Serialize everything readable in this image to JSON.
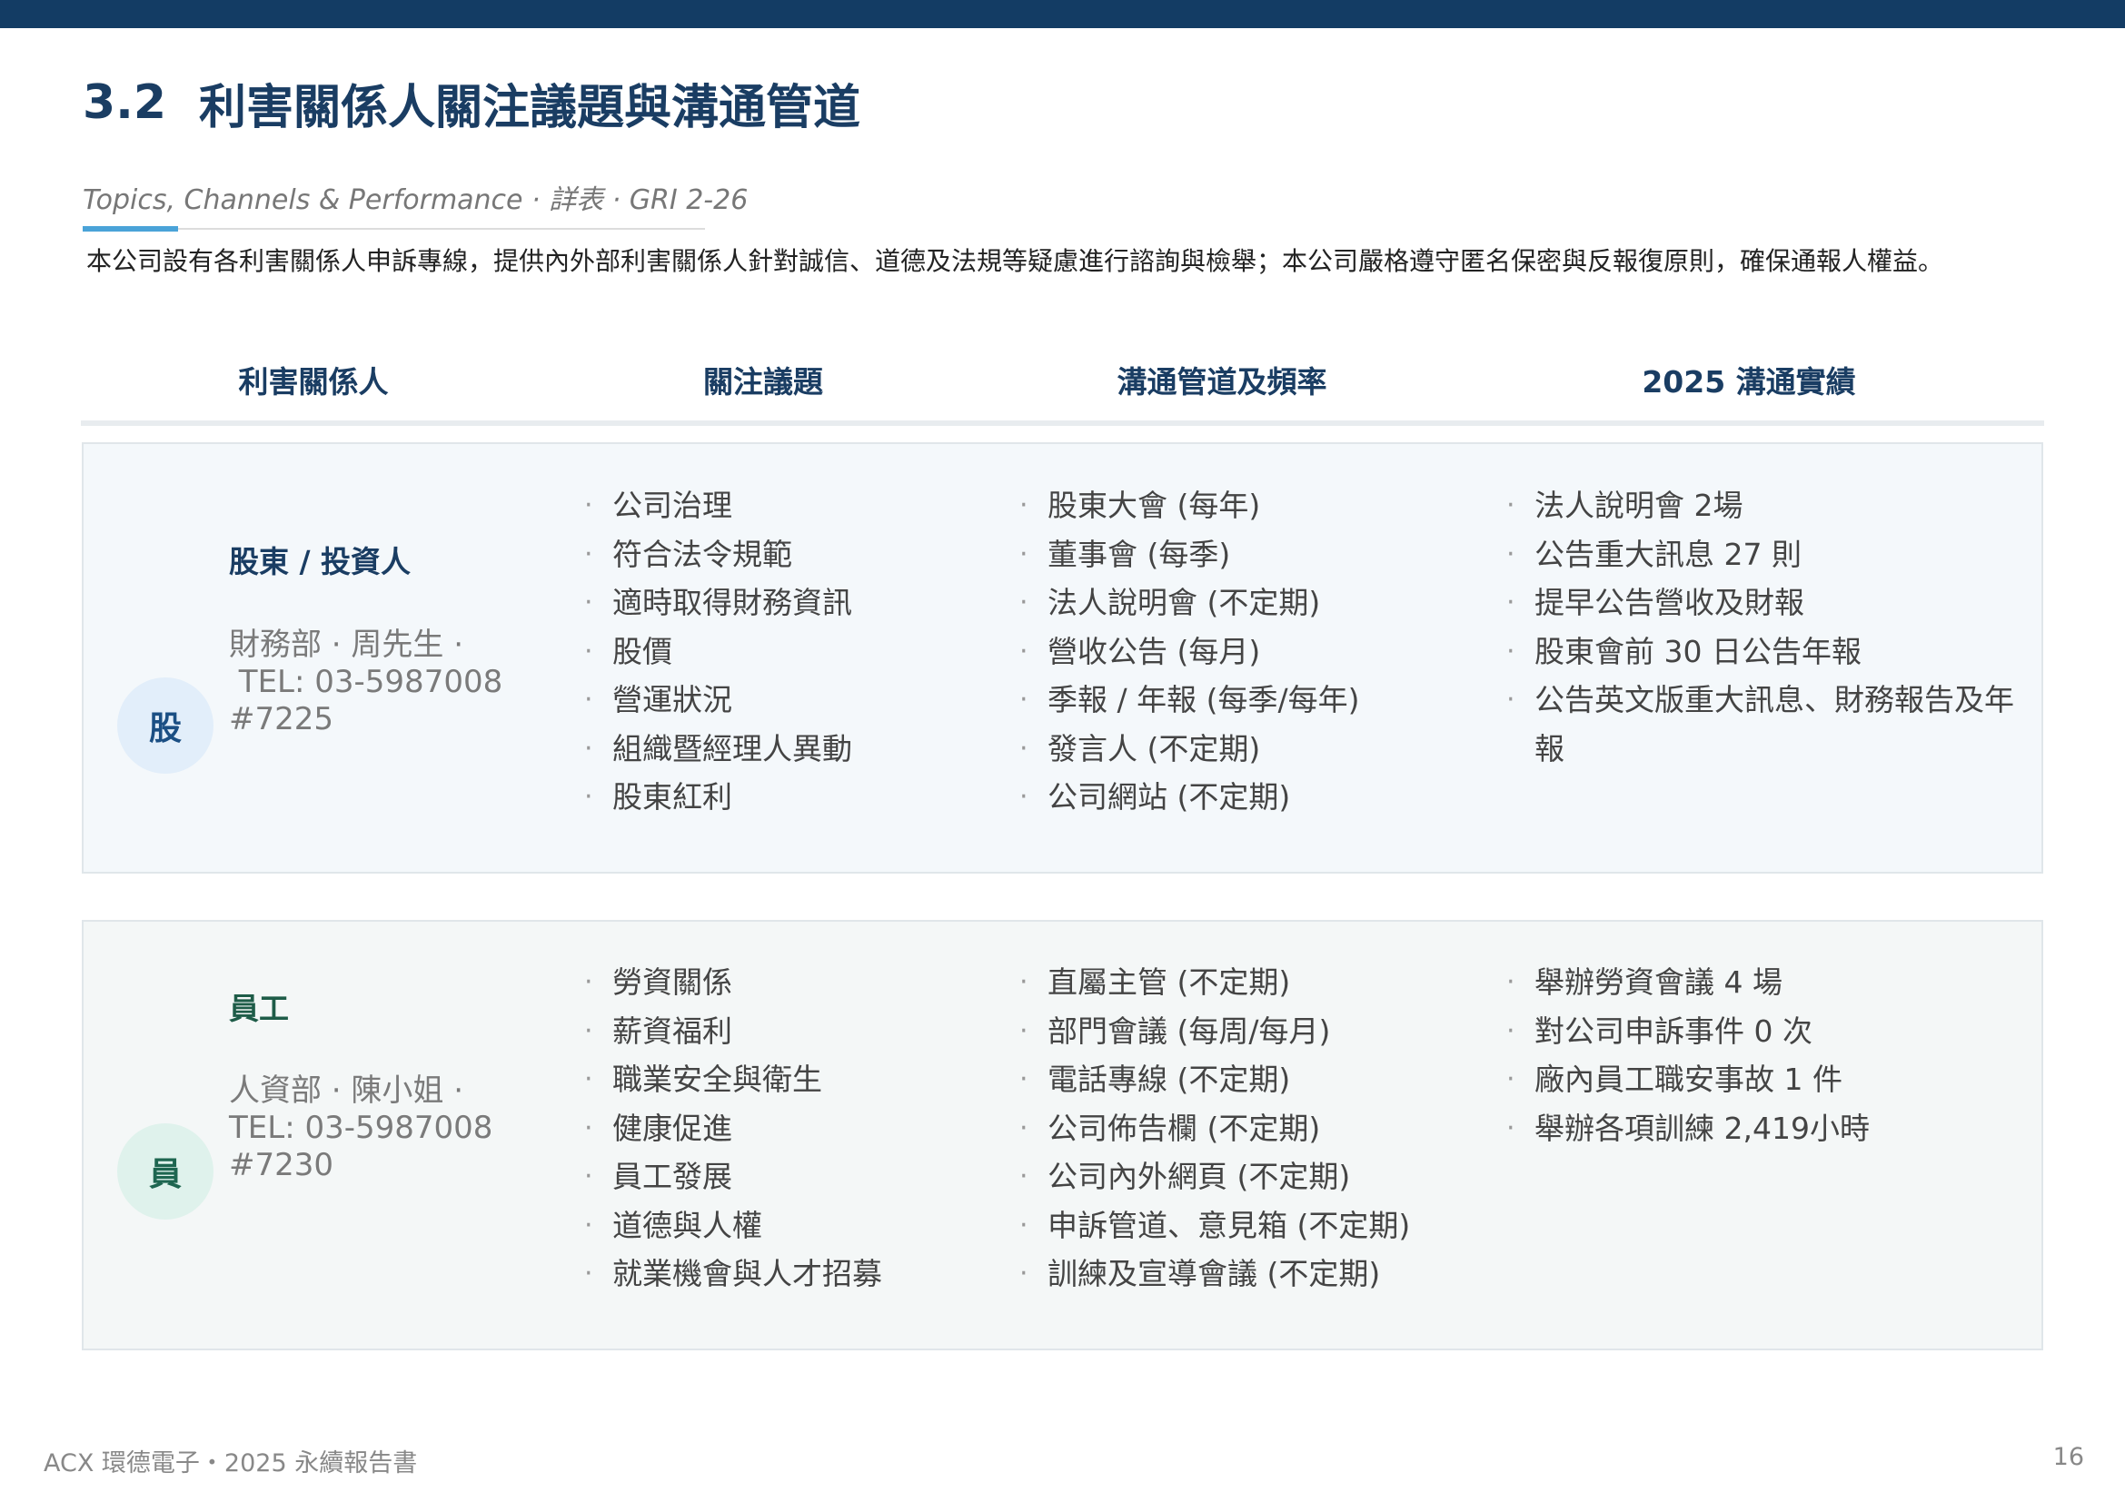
{
  "section": {
    "number": "3.2",
    "title": "利害關係人關注議題與溝通管道",
    "subtitle": "Topics, Channels & Performance · 詳表 · GRI 2-26"
  },
  "intro": "本公司設有各利害關係人申訴專線，提供內外部利害關係人針對誠信、道德及法規等疑慮進行諮詢與檢舉；本公司嚴格遵守匿名保密與反報復原則，確保通報人權益。",
  "columns": [
    "利害關係人",
    "關注議題",
    "溝通管道及頻率",
    "2025 溝通實績"
  ],
  "stakeholders": [
    {
      "badge": "股",
      "name": "股東 / 投資人",
      "contact": [
        "財務部 · 周先生 ·",
        " TEL: 03-5987008",
        "#7225"
      ],
      "topics": [
        "公司治理",
        "符合法令規範",
        "適時取得財務資訊",
        "股價",
        "營運狀況",
        "組織暨經理人異動",
        "股東紅利"
      ],
      "channels": [
        "股東大會 (每年)",
        "董事會 (每季)",
        "法人說明會 (不定期)",
        "營收公告 (每月)",
        "季報 / 年報 (每季/每年)",
        "發言人 (不定期)",
        "公司網站 (不定期)"
      ],
      "results": [
        "法人說明會 2場",
        "公告重大訊息 27 則",
        "提早公告營收及財報",
        "股東會前 30 日公告年報",
        "公告英文版重大訊息、財務報告及年報"
      ]
    },
    {
      "badge": "員",
      "name": "員工",
      "contact": [
        "人資部 · 陳小姐 ·",
        "TEL: 03-5987008",
        "#7230"
      ],
      "topics": [
        "勞資關係",
        "薪資福利",
        "職業安全與衛生",
        "健康促進",
        "員工發展",
        "道德與人權",
        "就業機會與人才招募"
      ],
      "channels": [
        "直屬主管 (不定期)",
        "部門會議 (每周/每月)",
        "電話專線 (不定期)",
        "公司佈告欄 (不定期)",
        "公司內外網頁 (不定期)",
        "申訴管道、意見箱 (不定期)",
        "訓練及宣導會議 (不定期)"
      ],
      "results": [
        "舉辦勞資會議 4 場",
        "對公司申訴事件 0 次",
        "廠內員工職安事故 1 件",
        "舉辦各項訓練 2,419小時"
      ]
    }
  ],
  "footer": {
    "left": "ACX 環德電子・2025 永續報告書",
    "page": "16"
  },
  "colors": {
    "topbar": "#133c64",
    "title": "#1a3d63",
    "accent": "#4aa3d8",
    "investor_badge": "#e2eefa",
    "employee_badge": "#dff2ec"
  }
}
